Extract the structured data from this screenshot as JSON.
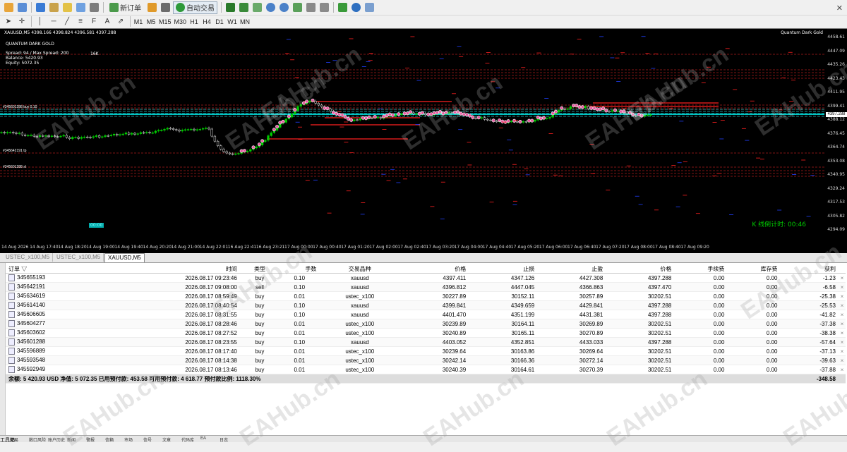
{
  "toolbar": {
    "new_order_label": "新订单",
    "autotrading_label": "自动交易",
    "timeframes": [
      "M1",
      "M5",
      "M15",
      "M30",
      "H1",
      "H4",
      "D1",
      "W1",
      "MN"
    ]
  },
  "chart": {
    "symbol_info": "XAUUSD,M5  4398.166 4398.824 4396.581 4397.288",
    "ea_name": "QUANTUM DARK GOLD",
    "ea_name_right": "Quantum Dark Gold",
    "panel_lines": [
      "Spread: 94 / Max Spread: 200",
      "Balance: 5420.93",
      "Equity: 5072.35"
    ],
    "big_label": "16K",
    "k_countdown": "K 线倒计时: 00:46",
    "time_badge": "00:00",
    "level_labels": [
      "#345642191 tp",
      "#345601288 buy 0.10",
      "#345601288 sl"
    ],
    "price_ticks": [
      "4458.61",
      "4447.09",
      "4435.26",
      "4423.43",
      "4411.95",
      "4399.41",
      "4388.12",
      "4376.45",
      "4364.74",
      "4353.08",
      "4340.95",
      "4329.24",
      "4317.53",
      "4305.82",
      "4294.09"
    ],
    "current_price": "4397.288",
    "time_ticks": [
      "14 Aug 2026",
      "14 Aug 17:40",
      "14 Aug 18:20",
      "14 Aug 19:00",
      "14 Aug 19:40",
      "14 Aug 20:20",
      "14 Aug 21:00",
      "14 Aug 22:01",
      "16 Aug 22:41",
      "16 Aug 23:21",
      "17 Aug 00:00",
      "17 Aug 00:40",
      "17 Aug 01:20",
      "17 Aug 02:00",
      "17 Aug 02:40",
      "17 Aug 03:20",
      "17 Aug 04:00",
      "17 Aug 04:40",
      "17 Aug 05:20",
      "17 Aug 06:00",
      "17 Aug 06:40",
      "17 Aug 07:20",
      "17 Aug 08:00",
      "17 Aug 08:40",
      "17 Aug 09:20"
    ]
  },
  "chart_tabs": [
    "USTEC_x100,M5",
    "USTEC_x100,M5",
    "XAUUSD,M5"
  ],
  "trade_table": {
    "columns": [
      "订单 ▽",
      "时间",
      "类型",
      "手数",
      "交易品种",
      "价格",
      "止损",
      "止盈",
      "价格",
      "手续费",
      "库存费",
      "获利"
    ],
    "rows": [
      [
        "345655193",
        "2026.08.17 09:23:46",
        "buy",
        "0.10",
        "xauusd",
        "4397.411",
        "4347.126",
        "4427.308",
        "4397.288",
        "0.00",
        "0.00",
        "-1.23"
      ],
      [
        "345642191",
        "2026.08.17 09:08:00",
        "sell",
        "0.10",
        "xauusd",
        "4396.812",
        "4447.045",
        "4366.863",
        "4397.470",
        "0.00",
        "0.00",
        "-6.58"
      ],
      [
        "345634619",
        "2026.08.17 08:59:49",
        "buy",
        "0.01",
        "ustec_x100",
        "30227.89",
        "30152.11",
        "30257.89",
        "30202.51",
        "0.00",
        "0.00",
        "-25.38"
      ],
      [
        "345614140",
        "2026.08.17 08:40:54",
        "buy",
        "0.10",
        "xauusd",
        "4399.841",
        "4349.659",
        "4429.841",
        "4397.288",
        "0.00",
        "0.00",
        "-25.53"
      ],
      [
        "345606605",
        "2026.08.17 08:31:55",
        "buy",
        "0.10",
        "xauusd",
        "4401.470",
        "4351.199",
        "4431.381",
        "4397.288",
        "0.00",
        "0.00",
        "-41.82"
      ],
      [
        "345604277",
        "2026.08.17 08:28:46",
        "buy",
        "0.01",
        "ustec_x100",
        "30239.89",
        "30164.11",
        "30269.89",
        "30202.51",
        "0.00",
        "0.00",
        "-37.38"
      ],
      [
        "345603602",
        "2026.08.17 08:27:52",
        "buy",
        "0.01",
        "ustec_x100",
        "30240.89",
        "30165.11",
        "30270.89",
        "30202.51",
        "0.00",
        "0.00",
        "-38.38"
      ],
      [
        "345601288",
        "2026.08.17 08:23:55",
        "buy",
        "0.10",
        "xauusd",
        "4403.052",
        "4352.851",
        "4433.033",
        "4397.288",
        "0.00",
        "0.00",
        "-57.64"
      ],
      [
        "345596889",
        "2026.08.17 08:17:40",
        "buy",
        "0.01",
        "ustec_x100",
        "30239.64",
        "30163.86",
        "30269.64",
        "30202.51",
        "0.00",
        "0.00",
        "-37.13"
      ],
      [
        "345593548",
        "2026.08.17 08:14:38",
        "buy",
        "0.01",
        "ustec_x100",
        "30242.14",
        "30166.36",
        "30272.14",
        "30202.51",
        "0.00",
        "0.00",
        "-39.63"
      ],
      [
        "345592949",
        "2026.08.17 08:13:46",
        "buy",
        "0.01",
        "ustec_x100",
        "30240.39",
        "30164.61",
        "30270.39",
        "30202.51",
        "0.00",
        "0.00",
        "-37.88"
      ]
    ],
    "summary_text": "余额: 5 420.93 USD  净值: 5 072.35  已用预付款: 453.58  可用预付款: 4 618.77  预付款比例: 1118.30%",
    "summary_profit": "-348.58"
  },
  "bottom_tabs": [
    "交易",
    "敞口风险",
    "账户历史",
    "新闻",
    "警报",
    "信箱",
    "市场",
    "信号",
    "文章",
    "代码库",
    "EA",
    "日志"
  ],
  "side_label": "工具箱",
  "watermark": "EAHub.cn",
  "colors": {
    "chart_bg": "#000000",
    "bull": "#00cc00",
    "level_red": "#ff2020",
    "level_cyan": "#00ffff",
    "panel_bg": "#ffffff"
  }
}
